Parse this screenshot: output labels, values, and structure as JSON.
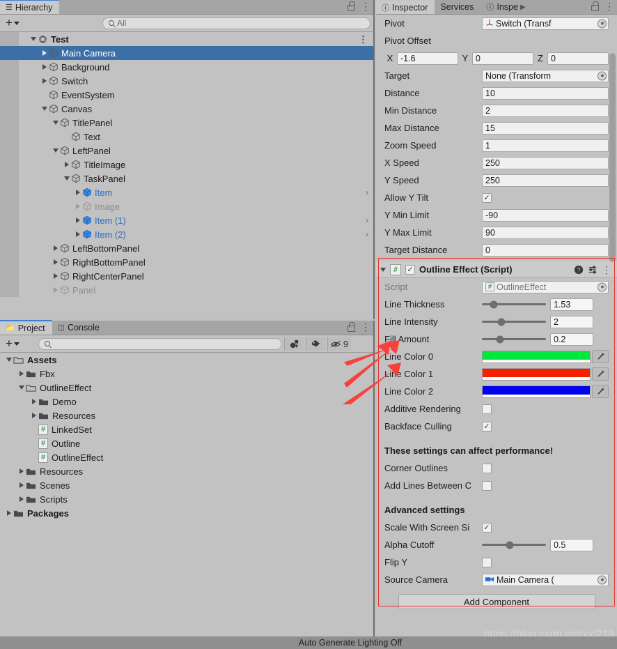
{
  "hierarchy": {
    "tab_label": "Hierarchy",
    "tab_icon": "hierarchy-icon",
    "create_label": "+",
    "search_placeholder": "All",
    "items": [
      {
        "label": "Test",
        "depth": 0,
        "twisty": "down",
        "icon": "unity-logo",
        "bold": true,
        "dim": false,
        "selected": false,
        "chevron": false,
        "kebab": true
      },
      {
        "label": "Main Camera",
        "depth": 1,
        "twisty": "right",
        "icon": "cube",
        "bold": false,
        "dim": false,
        "selected": true,
        "chevron": false,
        "kebab": false
      },
      {
        "label": "Background",
        "depth": 1,
        "twisty": "right",
        "icon": "cube",
        "bold": false,
        "dim": false,
        "selected": false,
        "chevron": false,
        "kebab": false
      },
      {
        "label": "Switch",
        "depth": 1,
        "twisty": "right",
        "icon": "cube",
        "bold": false,
        "dim": false,
        "selected": false,
        "chevron": false,
        "kebab": false
      },
      {
        "label": "EventSystem",
        "depth": 1,
        "twisty": "none",
        "icon": "cube",
        "bold": false,
        "dim": false,
        "selected": false,
        "chevron": false,
        "kebab": false
      },
      {
        "label": "Canvas",
        "depth": 1,
        "twisty": "down",
        "icon": "cube",
        "bold": false,
        "dim": false,
        "selected": false,
        "chevron": false,
        "kebab": false
      },
      {
        "label": "TitlePanel",
        "depth": 2,
        "twisty": "down",
        "icon": "cube",
        "bold": false,
        "dim": false,
        "selected": false,
        "chevron": false,
        "kebab": false
      },
      {
        "label": "Text",
        "depth": 3,
        "twisty": "none",
        "icon": "cube",
        "bold": false,
        "dim": false,
        "selected": false,
        "chevron": false,
        "kebab": false
      },
      {
        "label": "LeftPanel",
        "depth": 2,
        "twisty": "down",
        "icon": "cube",
        "bold": false,
        "dim": false,
        "selected": false,
        "chevron": false,
        "kebab": false
      },
      {
        "label": "TitleImage",
        "depth": 3,
        "twisty": "right",
        "icon": "cube",
        "bold": false,
        "dim": false,
        "selected": false,
        "chevron": false,
        "kebab": false
      },
      {
        "label": "TaskPanel",
        "depth": 3,
        "twisty": "down",
        "icon": "cube",
        "bold": false,
        "dim": false,
        "selected": false,
        "chevron": false,
        "kebab": false
      },
      {
        "label": "Item",
        "depth": 4,
        "twisty": "right",
        "icon": "prefab",
        "bold": false,
        "dim": false,
        "selected": false,
        "chevron": true,
        "kebab": false
      },
      {
        "label": "Image",
        "depth": 4,
        "twisty": "right",
        "icon": "cube",
        "bold": false,
        "dim": true,
        "selected": false,
        "chevron": false,
        "kebab": false
      },
      {
        "label": "Item (1)",
        "depth": 4,
        "twisty": "right",
        "icon": "prefab",
        "bold": false,
        "dim": false,
        "selected": false,
        "chevron": true,
        "kebab": false
      },
      {
        "label": "Item (2)",
        "depth": 4,
        "twisty": "right",
        "icon": "prefab",
        "bold": false,
        "dim": false,
        "selected": false,
        "chevron": true,
        "kebab": false
      },
      {
        "label": "LeftBottomPanel",
        "depth": 2,
        "twisty": "right",
        "icon": "cube",
        "bold": false,
        "dim": false,
        "selected": false,
        "chevron": false,
        "kebab": false
      },
      {
        "label": "RightBottomPanel",
        "depth": 2,
        "twisty": "right",
        "icon": "cube",
        "bold": false,
        "dim": false,
        "selected": false,
        "chevron": false,
        "kebab": false
      },
      {
        "label": "RightCenterPanel",
        "depth": 2,
        "twisty": "right",
        "icon": "cube",
        "bold": false,
        "dim": false,
        "selected": false,
        "chevron": false,
        "kebab": false
      },
      {
        "label": "Panel",
        "depth": 2,
        "twisty": "right",
        "icon": "cube",
        "bold": false,
        "dim": true,
        "selected": false,
        "chevron": false,
        "kebab": false
      }
    ]
  },
  "project": {
    "tabs": [
      {
        "label": "Project",
        "icon": "folder-icon",
        "active": true
      },
      {
        "label": "Console",
        "icon": "console-icon",
        "active": false
      }
    ],
    "create_label": "+",
    "search_placeholder": "",
    "filter_icons": [
      "type-filter-icon",
      "label-filter-icon",
      "hidden-packages-icon"
    ],
    "hidden_count": "9",
    "items": [
      {
        "label": "Assets",
        "depth": 0,
        "twisty": "down",
        "icon": "folder-open",
        "bold": true
      },
      {
        "label": "Fbx",
        "depth": 1,
        "twisty": "right",
        "icon": "folder",
        "bold": false
      },
      {
        "label": "OutlineEffect",
        "depth": 1,
        "twisty": "down",
        "icon": "folder-open",
        "bold": false
      },
      {
        "label": "Demo",
        "depth": 2,
        "twisty": "right",
        "icon": "folder",
        "bold": false
      },
      {
        "label": "Resources",
        "depth": 2,
        "twisty": "right",
        "icon": "folder",
        "bold": false
      },
      {
        "label": "LinkedSet",
        "depth": 2,
        "twisty": "none",
        "icon": "cs-script",
        "bold": false
      },
      {
        "label": "Outline",
        "depth": 2,
        "twisty": "none",
        "icon": "cs-script",
        "bold": false
      },
      {
        "label": "OutlineEffect",
        "depth": 2,
        "twisty": "none",
        "icon": "cs-script",
        "bold": false
      },
      {
        "label": "Resources",
        "depth": 1,
        "twisty": "right",
        "icon": "folder",
        "bold": false
      },
      {
        "label": "Scenes",
        "depth": 1,
        "twisty": "right",
        "icon": "folder",
        "bold": false
      },
      {
        "label": "Scripts",
        "depth": 1,
        "twisty": "right",
        "icon": "folder",
        "bold": false
      },
      {
        "label": "Packages",
        "depth": 0,
        "twisty": "right",
        "icon": "folder",
        "bold": true
      }
    ]
  },
  "inspector": {
    "tabs": [
      {
        "label": "Inspector",
        "active": true
      },
      {
        "label": "Services",
        "active": false
      },
      {
        "label": "Inspe",
        "active": false
      }
    ],
    "overflow_arrow": "▶",
    "camera_component": {
      "rows": [
        {
          "type": "label_only",
          "label": "Pivot",
          "value": "Switch (Transf",
          "field": "object",
          "icon": "transform-icon"
        },
        {
          "type": "header",
          "label": "Pivot Offset"
        },
        {
          "type": "vector3",
          "label": "",
          "axes": [
            "X",
            "Y",
            "Z"
          ],
          "values": [
            "-1.6",
            "0",
            "0"
          ]
        },
        {
          "type": "object",
          "label": "Target",
          "value": "None (Transform"
        },
        {
          "type": "text",
          "label": "Distance",
          "value": "10"
        },
        {
          "type": "text",
          "label": "Min Distance",
          "value": "2"
        },
        {
          "type": "text",
          "label": "Max Distance",
          "value": "15"
        },
        {
          "type": "text",
          "label": "Zoom Speed",
          "value": "1"
        },
        {
          "type": "text",
          "label": "X Speed",
          "value": "250"
        },
        {
          "type": "text",
          "label": "Y Speed",
          "value": "250"
        },
        {
          "type": "check",
          "label": "Allow Y Tilt",
          "checked": true
        },
        {
          "type": "text",
          "label": "Y Min Limit",
          "value": "-90"
        },
        {
          "type": "text",
          "label": "Y Max Limit",
          "value": "90"
        },
        {
          "type": "text",
          "label": "Target Distance",
          "value": "0"
        }
      ]
    },
    "outline_component": {
      "title": "Outline Effect (Script)",
      "enabled": true,
      "expanded": true,
      "badge": "#",
      "help_icon": "help-icon",
      "preset_icon": "preset-icon",
      "menu_icon": "kebab-icon",
      "rows": [
        {
          "type": "object",
          "label": "Script",
          "value": "OutlineEffect",
          "dim": true,
          "badge": "#"
        },
        {
          "type": "slider",
          "label": "Line Thickness",
          "value": "1.53",
          "knob_pct": 18
        },
        {
          "type": "slider",
          "label": "Line Intensity",
          "value": "2",
          "knob_pct": 30
        },
        {
          "type": "slider",
          "label": "Fill Amount",
          "value": "0.2",
          "knob_pct": 28
        },
        {
          "type": "color",
          "label": "Line Color 0",
          "color": "#00e83c"
        },
        {
          "type": "color",
          "label": "Line Color 1",
          "color": "#f52000"
        },
        {
          "type": "color",
          "label": "Line Color 2",
          "color": "#0000f0"
        },
        {
          "type": "check",
          "label": "Additive Rendering",
          "checked": false
        },
        {
          "type": "check",
          "label": "Backface Culling",
          "checked": true
        },
        {
          "type": "spacer"
        },
        {
          "type": "section",
          "label": "These settings can affect performance!"
        },
        {
          "type": "check",
          "label": "Corner Outlines",
          "checked": false
        },
        {
          "type": "check",
          "label": "Add Lines Between C",
          "checked": false
        },
        {
          "type": "spacer"
        },
        {
          "type": "section",
          "label": "Advanced settings"
        },
        {
          "type": "check",
          "label": "Scale With Screen Si",
          "checked": true
        },
        {
          "type": "slider",
          "label": "Alpha Cutoff",
          "value": "0.5",
          "knob_pct": 44
        },
        {
          "type": "check",
          "label": "Flip Y",
          "checked": false
        },
        {
          "type": "object",
          "label": "Source Camera",
          "value": "Main Camera (",
          "icon": "camera-icon"
        }
      ]
    },
    "add_component_label": "Add Component"
  },
  "annotations": {
    "watermark": "https://blog.csdn.net/yxl219",
    "highlight_color": "#e8332a",
    "arrow_targets": [
      "Line Intensity",
      "Line Color 0",
      "Line Color 1"
    ]
  },
  "statusbar": {
    "text": "Auto Generate Lighting Off"
  }
}
